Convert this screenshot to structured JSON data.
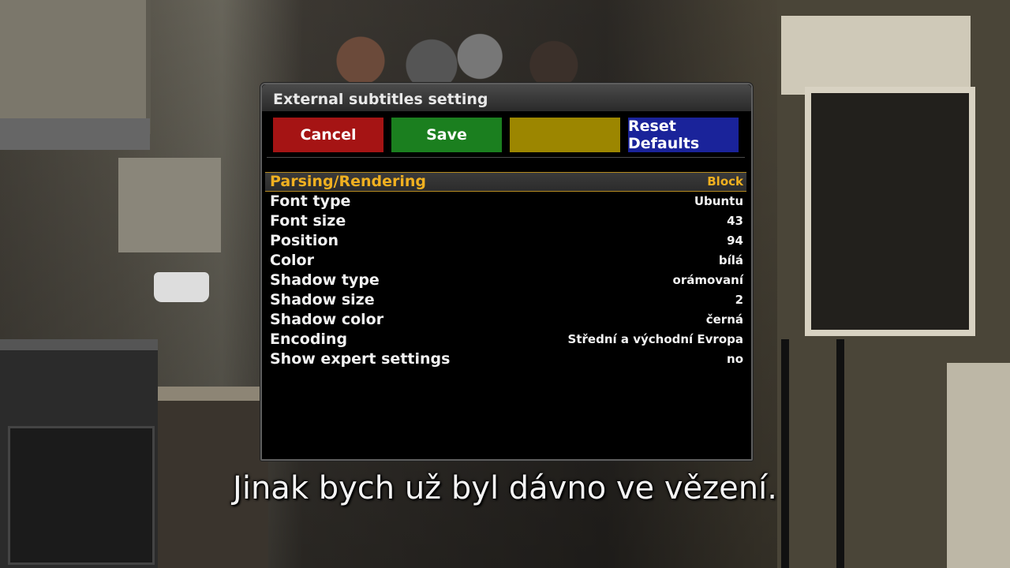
{
  "dialog": {
    "title": "External subtitles setting",
    "buttons": {
      "cancel": "Cancel",
      "save": "Save",
      "yellow": "",
      "reset": "Reset Defaults"
    },
    "colors": {
      "cancel": "#a51414",
      "save": "#1b7f1f",
      "yellow": "#9c8600",
      "reset": "#1a239a",
      "selected_text": "#f0b020"
    },
    "items": [
      {
        "label": "Parsing/Rendering",
        "value": "Block",
        "selected": true
      },
      {
        "label": "Font type",
        "value": "Ubuntu"
      },
      {
        "label": "Font size",
        "value": "43"
      },
      {
        "label": "Position",
        "value": "94"
      },
      {
        "label": "Color",
        "value": "bílá"
      },
      {
        "label": "Shadow type",
        "value": "orámovaní"
      },
      {
        "label": "Shadow size",
        "value": "2"
      },
      {
        "label": "Shadow color",
        "value": "černá"
      },
      {
        "label": "Encoding",
        "value": "Střední a východní Evropa"
      },
      {
        "label": "Show expert settings",
        "value": "no"
      }
    ]
  },
  "subtitle": {
    "text": "Jinak bych už byl dávno ve vězení."
  }
}
